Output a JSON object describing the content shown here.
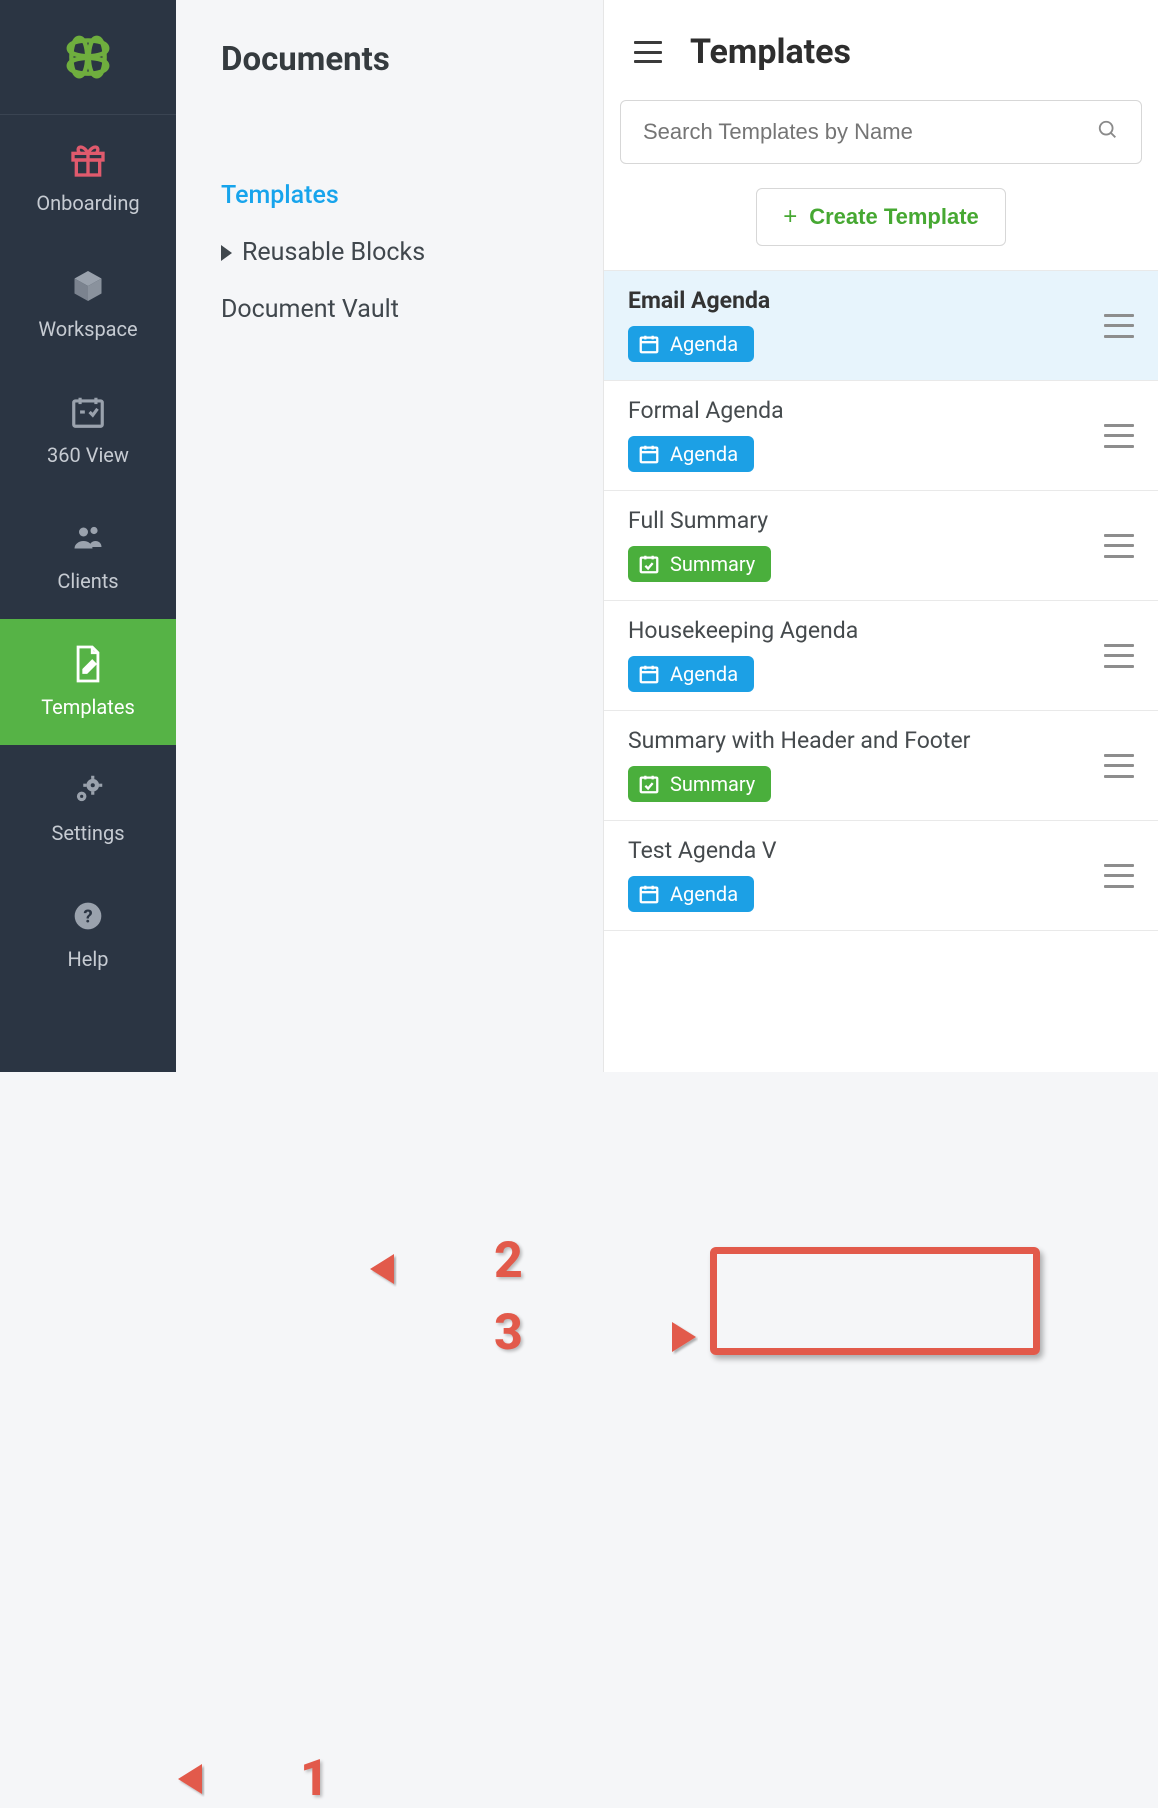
{
  "nav": {
    "items": [
      {
        "key": "onboarding",
        "label": "Onboarding"
      },
      {
        "key": "workspace",
        "label": "Workspace"
      },
      {
        "key": "360view",
        "label": "360 View"
      },
      {
        "key": "clients",
        "label": "Clients"
      },
      {
        "key": "templates",
        "label": "Templates"
      },
      {
        "key": "settings",
        "label": "Settings"
      },
      {
        "key": "help",
        "label": "Help"
      }
    ]
  },
  "panel": {
    "title": "Documents",
    "subnav": [
      {
        "label": "Templates",
        "active": true
      },
      {
        "label": "Reusable Blocks"
      },
      {
        "label": "Document Vault"
      }
    ]
  },
  "templates": {
    "title": "Templates",
    "search_placeholder": "Search Templates by Name",
    "create_label": "Create Template",
    "list": [
      {
        "name": "Email Agenda",
        "tag": "Agenda",
        "tag_type": "agenda",
        "selected": true
      },
      {
        "name": "Formal Agenda",
        "tag": "Agenda",
        "tag_type": "agenda"
      },
      {
        "name": "Full Summary",
        "tag": "Summary",
        "tag_type": "summary"
      },
      {
        "name": "Housekeeping Agenda",
        "tag": "Agenda",
        "tag_type": "agenda"
      },
      {
        "name": "Summary with Header and Footer",
        "tag": "Summary",
        "tag_type": "summary"
      },
      {
        "name": "Test Agenda V",
        "tag": "Agenda",
        "tag_type": "agenda"
      }
    ]
  },
  "annotations": {
    "num1": "1",
    "num2": "2",
    "num3": "3"
  }
}
